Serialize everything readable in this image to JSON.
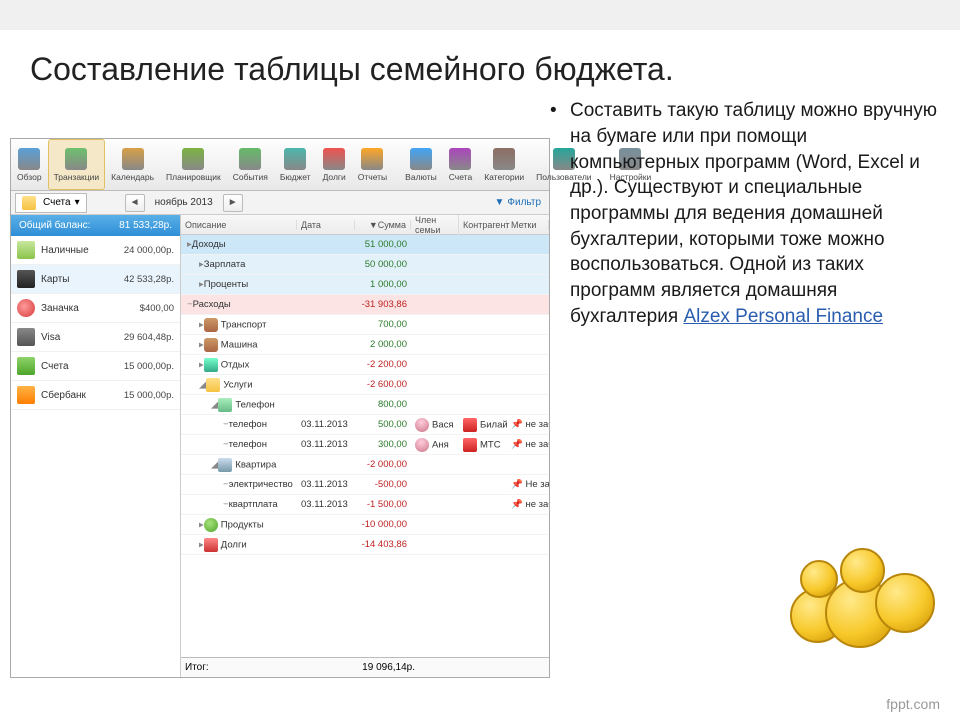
{
  "slide": {
    "title": "Составление таблицы семейного бюджета.",
    "bullet": "•",
    "text_prefix": "Составить такую таблицу можно вручную на бумаге или при помощи компьютерных программ (Word, Excel и др.). Существуют и специальные программы для ведения домашней бухгалтерии, которыми тоже можно воспользоваться. Одной из таких программ является домашняя бухгалтерия ",
    "link_text": "Alzex Personal Finance"
  },
  "watermark": "fppt.com",
  "toolbar": {
    "items": [
      {
        "label": "Обзор",
        "active": false
      },
      {
        "label": "Транзакции",
        "active": true
      },
      {
        "label": "Календарь",
        "active": false
      },
      {
        "label": "Планировщик",
        "active": false
      },
      {
        "label": "События",
        "active": false
      },
      {
        "label": "Бюджет",
        "active": false
      },
      {
        "label": "Долги",
        "active": false
      },
      {
        "label": "Отчеты",
        "active": false
      },
      {
        "label": "Валюты",
        "active": false
      },
      {
        "label": "Счета",
        "active": false
      },
      {
        "label": "Категории",
        "active": false
      },
      {
        "label": "Пользователи",
        "active": false
      },
      {
        "label": "Настройки",
        "active": false
      }
    ]
  },
  "subbar": {
    "accounts_dropdown": "Счета",
    "prev": "◄",
    "next": "►",
    "period": "ноябрь 2013",
    "filter": "Фильтр"
  },
  "sidebar": {
    "balance_label": "Общий баланс:",
    "balance_value": "81 533,28р.",
    "rows": [
      {
        "name": "Наличные",
        "amt": "24 000,00р."
      },
      {
        "name": "Карты",
        "amt": "42 533,28р."
      },
      {
        "name": "Заначка",
        "amt": "$400,00"
      },
      {
        "name": "Visa",
        "amt": "29 604,48р."
      },
      {
        "name": "Счета",
        "amt": "15 000,00р."
      },
      {
        "name": "Сбербанк",
        "amt": "15 000,00р."
      }
    ]
  },
  "grid": {
    "headers": {
      "desc": "Описание",
      "date": "Дата",
      "sum": "▼Сумма",
      "mem": "Член семьи",
      "agent": "Контрагент",
      "tag": "Метки"
    },
    "rows": [
      {
        "cls": "blue",
        "indent": 0,
        "exp": "▸",
        "desc": "Доходы",
        "date": "",
        "sum": "51 000,00",
        "neg": false
      },
      {
        "cls": "blue2",
        "indent": 1,
        "exp": "▸",
        "desc": "Зарплата",
        "date": "",
        "sum": "50 000,00",
        "neg": false
      },
      {
        "cls": "blue2",
        "indent": 1,
        "exp": "▸",
        "desc": "Проценты",
        "date": "",
        "sum": "1 000,00",
        "neg": false
      },
      {
        "cls": "pink",
        "indent": 0,
        "exp": "−",
        "desc": "Расходы",
        "date": "",
        "sum": "-31 903,86",
        "neg": true
      },
      {
        "cls": "",
        "indent": 1,
        "exp": "▸",
        "ic": "i-car",
        "desc": "Транспорт",
        "date": "",
        "sum": "700,00",
        "neg": false
      },
      {
        "cls": "",
        "indent": 1,
        "exp": "▸",
        "ic": "i-car",
        "desc": "Машина",
        "date": "",
        "sum": "2 000,00",
        "neg": false
      },
      {
        "cls": "",
        "indent": 1,
        "exp": "▸",
        "ic": "i-palm",
        "desc": "Отдых",
        "date": "",
        "sum": "-2 200,00",
        "neg": true
      },
      {
        "cls": "",
        "indent": 1,
        "exp": "◢",
        "ic": "i-folder",
        "desc": "Услуги",
        "date": "",
        "sum": "-2 600,00",
        "neg": true
      },
      {
        "cls": "",
        "indent": 2,
        "exp": "◢",
        "ic": "i-phone",
        "desc": "Телефон",
        "date": "",
        "sum": "800,00",
        "neg": false
      },
      {
        "cls": "",
        "indent": 3,
        "exp": "−",
        "desc": "телефон",
        "date": "03.11.2013",
        "sum": "500,00",
        "neg": false,
        "mem": "Вася",
        "agent": "Билайн",
        "tag": "не забыть",
        "pin": true
      },
      {
        "cls": "",
        "indent": 3,
        "exp": "−",
        "desc": "телефон",
        "date": "03.11.2013",
        "sum": "300,00",
        "neg": false,
        "mem": "Аня",
        "agent": "МТС",
        "tag": "не забыть",
        "pin": true
      },
      {
        "cls": "",
        "indent": 2,
        "exp": "◢",
        "ic": "i-home",
        "desc": "Квартира",
        "date": "",
        "sum": "-2 000,00",
        "neg": true
      },
      {
        "cls": "",
        "indent": 3,
        "exp": "−",
        "desc": "электричество",
        "date": "03.11.2013",
        "sum": "-500,00",
        "neg": true,
        "tag": "Не забыть",
        "pin": true
      },
      {
        "cls": "",
        "indent": 3,
        "exp": "−",
        "desc": "квартплата",
        "date": "03.11.2013",
        "sum": "-1 500,00",
        "neg": true,
        "tag": "не забыть",
        "pin": true
      },
      {
        "cls": "",
        "indent": 1,
        "exp": "▸",
        "ic": "i-apple",
        "desc": "Продукты",
        "date": "",
        "sum": "-10 000,00",
        "neg": true
      },
      {
        "cls": "",
        "indent": 1,
        "exp": "▸",
        "ic": "i-red",
        "desc": "Долги",
        "date": "",
        "sum": "-14 403,86",
        "neg": true
      }
    ],
    "total_label": "Итог:",
    "total_value": "19 096,14р."
  }
}
